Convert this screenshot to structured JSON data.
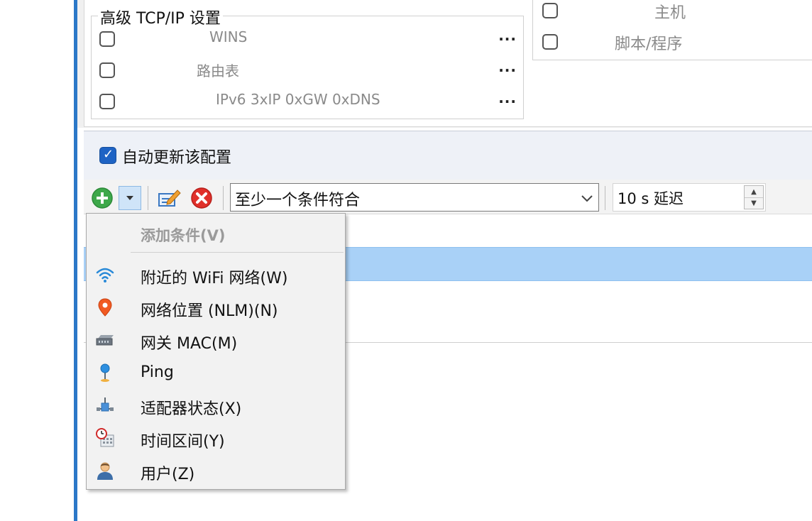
{
  "advanced_group": {
    "title": "高级 TCP/IP 设置",
    "items": [
      {
        "label": "WINS",
        "checked": false,
        "more": "..."
      },
      {
        "label": "路由表",
        "checked": false,
        "more": "..."
      },
      {
        "label": "IPv6 3xIP 0xGW 0xDNS",
        "checked": false,
        "more": "..."
      }
    ]
  },
  "right_group": {
    "items": [
      {
        "label": "主机",
        "checked": false
      },
      {
        "label": "脚本/程序",
        "checked": false
      }
    ]
  },
  "auto_update": {
    "label": "自动更新该配置",
    "checked": true
  },
  "toolbar": {
    "condition_mode": "至少一个条件符合",
    "delay_value": "10 s 延迟"
  },
  "add_menu": {
    "header": "添加条件(V)",
    "items": [
      {
        "label": "附近的 WiFi 网络(W)",
        "icon": "wifi-icon"
      },
      {
        "label": "网络位置 (NLM)(N)",
        "icon": "location-pin-icon"
      },
      {
        "label": "网关 MAC(M)",
        "icon": "router-icon"
      },
      {
        "label": "Ping",
        "icon": "ping-icon"
      },
      {
        "label": "适配器状态(X)",
        "icon": "network-adapter-icon"
      },
      {
        "label": "时间区间(Y)",
        "icon": "clock-calendar-icon"
      },
      {
        "label": "用户(Z)",
        "icon": "user-icon"
      }
    ]
  },
  "colors": {
    "accent": "#2b78c8",
    "selection": "#a9d1f7",
    "add_green": "#3ea84a",
    "delete_red": "#e0302a"
  }
}
